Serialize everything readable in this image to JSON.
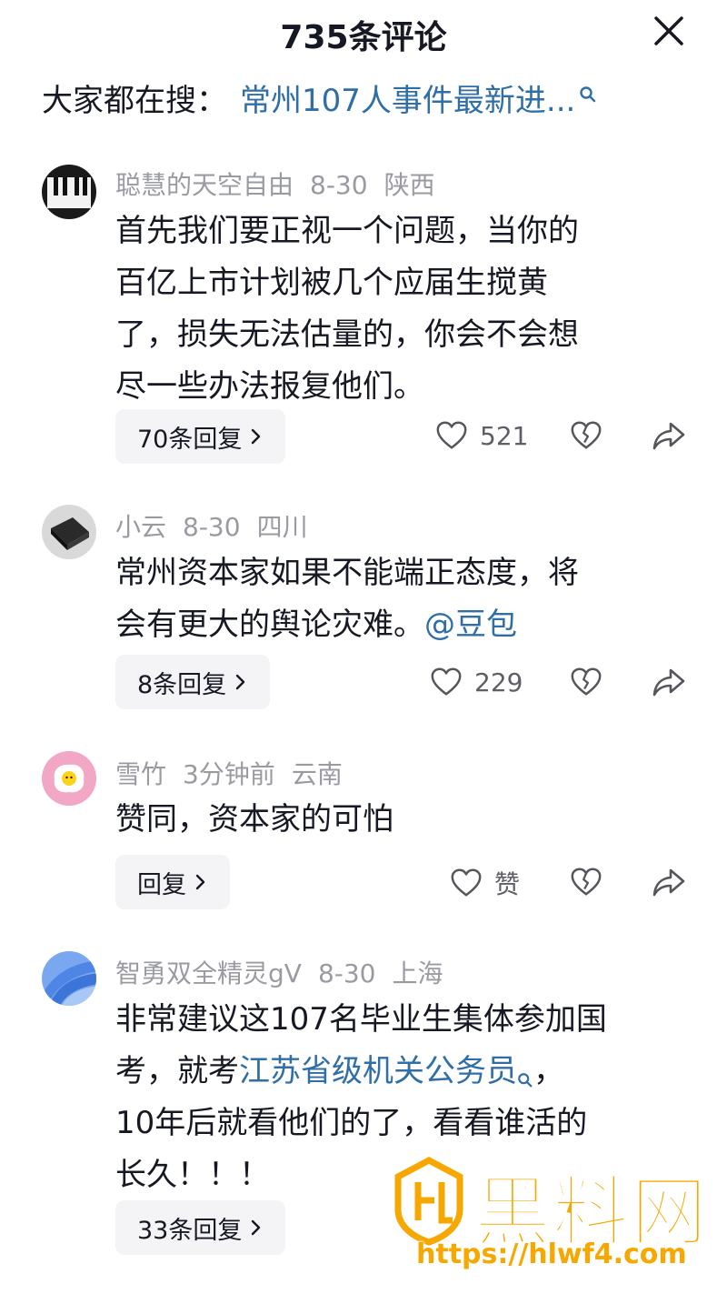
{
  "header": {
    "title": "735条评论"
  },
  "search": {
    "prefix": "大家都在搜：",
    "term": "常州107人事件最新进..."
  },
  "comments": [
    {
      "user": "聪慧的天空自由",
      "date": "8-30",
      "location": "陕西",
      "lines": [
        "首先我们要正视一个问题，当你的",
        "百亿上市计划被几个应届生搅黄",
        "了，损失无法估量的，你会不会想",
        "尽一些办法报复他们。"
      ],
      "reply_label": "70条回复",
      "likes": "521"
    },
    {
      "user": "小云",
      "date": "8-30",
      "location": "四川",
      "lines": [
        "常州资本家如果不能端正态度，将",
        "会有更大的舆论灾难。"
      ],
      "mention": "@豆包",
      "reply_label": "8条回复",
      "likes": "229"
    },
    {
      "user": "雪竹",
      "date": "3分钟前",
      "location": "云南",
      "lines": [
        "赞同，资本家的可怕"
      ],
      "reply_label": "回复",
      "likes": "赞"
    },
    {
      "user": "智勇双全精灵gV",
      "date": "8-30",
      "location": "上海",
      "line1": "非常建议这107名毕业生集体参加国",
      "line2_pre": "考，就考",
      "line2_link": "江苏省级机关公务员",
      "line2_post": "，",
      "line3": "10年后就看他们的了，看看谁活的",
      "line4": "长久！！！",
      "reply_label": "33条回复"
    }
  ],
  "watermark": {
    "brand": "黑料网",
    "url": "https://hlwf4.com"
  },
  "colors": {
    "link": "#2f6ea6",
    "meta": "#9a9ba2",
    "text": "#161823",
    "watermark": "#f6a800"
  }
}
